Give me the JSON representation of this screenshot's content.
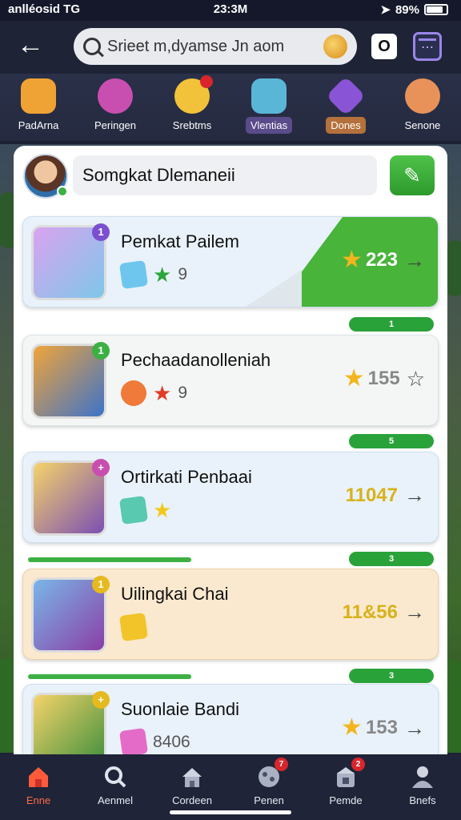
{
  "status_bar": {
    "carrier": "anlléosid TG",
    "time": "23:3M",
    "battery": "89%"
  },
  "header": {
    "back_icon": "arrow-left-icon",
    "search_value": "Srieet m,dyamse Jn aom",
    "o_button": "O"
  },
  "categories": [
    {
      "label": "PadArna",
      "color": "#f0a335"
    },
    {
      "label": "Peringen",
      "color": "#c84fb0"
    },
    {
      "label": "Srebtms",
      "color": "#f2c23a"
    },
    {
      "label": "Vlentias",
      "color": "#5ab6d6",
      "style": "purple"
    },
    {
      "label": "Dones",
      "color": "#8a54d6",
      "style": "orange"
    },
    {
      "label": "Senone",
      "color": "#e8925a"
    }
  ],
  "profile": {
    "name": "Somgkat Dlemaneii",
    "edit_icon": "pencil-icon"
  },
  "cards": [
    {
      "title": "Pemkat Pailem",
      "items_count": "9",
      "reward": "223",
      "badge": "1",
      "badge_color": "#7a4fd0",
      "gem_color": "#6ec6ef",
      "star_color": "#2ca63c",
      "theme": "blue",
      "pill": ""
    },
    {
      "title": "Pechaadanolleniah",
      "items_count": "9",
      "reward": "155",
      "badge": "1",
      "badge_color": "#3cb043",
      "gem_color": "#f07a3a",
      "star_color": "#e23b24",
      "theme": "grey",
      "pill": "1"
    },
    {
      "title": "Ortirkati Penbaai",
      "items_count": "",
      "reward": "11047",
      "badge": "+",
      "badge_color": "#c84fb0",
      "gem_color": "#59c9b0",
      "star_color": "#f2c81e",
      "theme": "blue",
      "pill": "5"
    },
    {
      "title": "Uilingkai Chai",
      "items_count": "",
      "reward": "11&56",
      "badge": "1",
      "badge_color": "#e6b91e",
      "gem_color": "#f2c42a",
      "star_color": "",
      "theme": "peach",
      "pill": "3"
    },
    {
      "title": "Suonlaie Bandi",
      "items_count": "8406",
      "reward": "153",
      "badge": "+",
      "badge_color": "#e6b91e",
      "gem_color": "#e56bc8",
      "star_color": "",
      "theme": "blue",
      "pill": "3"
    }
  ],
  "nav": [
    {
      "label": "Enne",
      "icon": "home-icon",
      "badge": ""
    },
    {
      "label": "Aenmel",
      "icon": "search-icon",
      "badge": ""
    },
    {
      "label": "Cordeen",
      "icon": "house-icon",
      "badge": ""
    },
    {
      "label": "Penen",
      "icon": "controller-icon",
      "badge": "7"
    },
    {
      "label": "Pemde",
      "icon": "store-icon",
      "badge": "2"
    },
    {
      "label": "Bnefs",
      "icon": "profile-icon",
      "badge": ""
    }
  ]
}
